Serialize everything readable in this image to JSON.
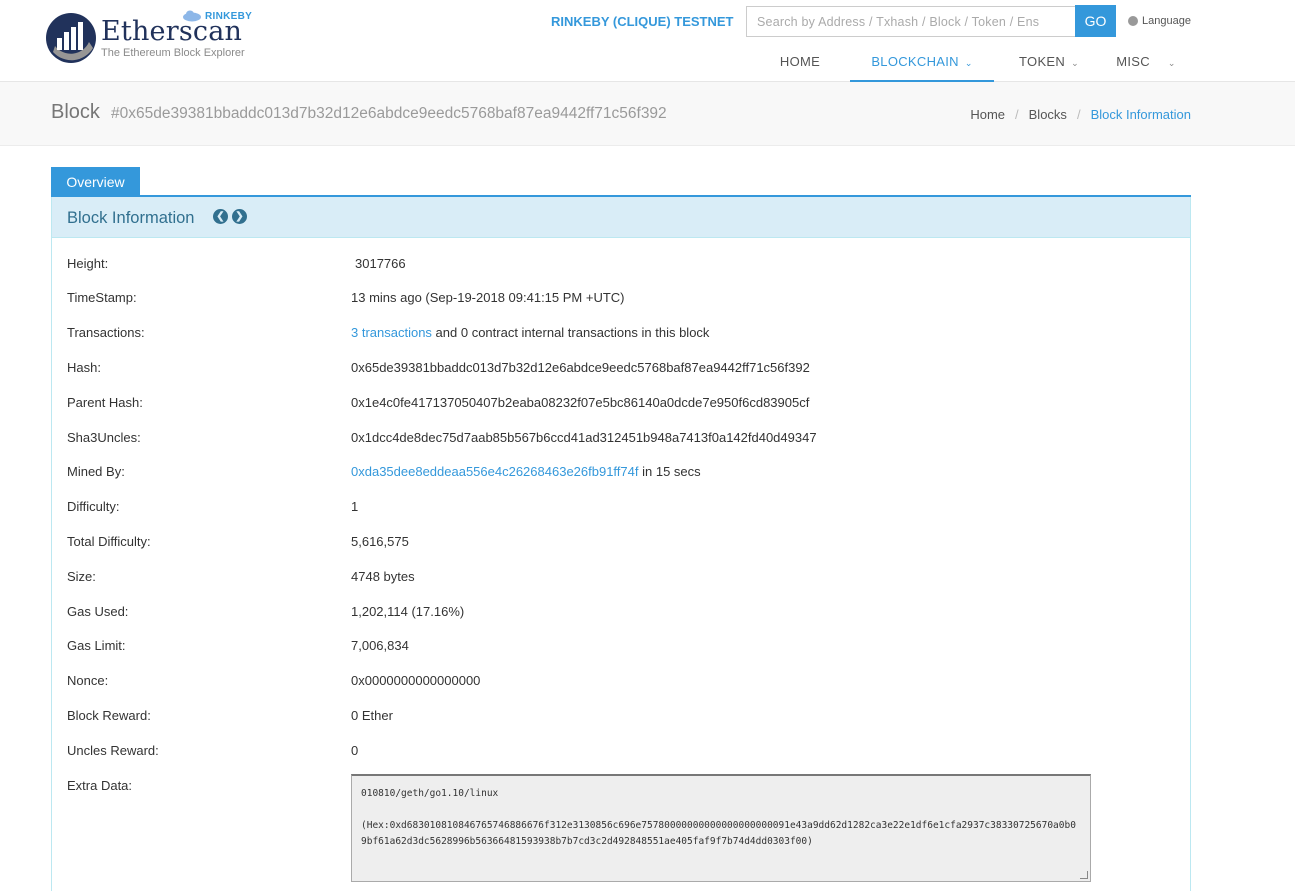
{
  "logo": {
    "wordmark": "Etherscan",
    "tagline": "The Ethereum Block Explorer",
    "network_badge": "RINKEBY"
  },
  "header": {
    "testnet_label": "RINKEBY (CLIQUE) TESTNET",
    "search_placeholder": "Search by Address / Txhash / Block / Token / Ens",
    "go_label": "GO",
    "language_label": "Language"
  },
  "nav": {
    "items": [
      {
        "label": "HOME"
      },
      {
        "label": "BLOCKCHAIN",
        "active": true
      },
      {
        "label": "TOKEN"
      },
      {
        "label": "MISC"
      }
    ]
  },
  "page": {
    "title": "Block",
    "hash": "#0x65de39381bbaddc013d7b32d12e6abdce9eedc5768baf87ea9442ff71c56f392"
  },
  "breadcrumb": [
    "Home",
    "Blocks",
    "Block Information"
  ],
  "tabs": {
    "overview": "Overview"
  },
  "panel": {
    "title": "Block Information"
  },
  "block": {
    "height_label": "Height:",
    "height": "3017766",
    "timestamp_label": "TimeStamp:",
    "timestamp": "13 mins ago (Sep-19-2018 09:41:15 PM +UTC)",
    "transactions_label": "Transactions:",
    "transactions_link": "3 transactions",
    "transactions_suffix": " and 0 contract internal transactions in this block",
    "hash_label": "Hash:",
    "hash": "0x65de39381bbaddc013d7b32d12e6abdce9eedc5768baf87ea9442ff71c56f392",
    "parent_hash_label": "Parent Hash:",
    "parent_hash": "0x1e4c0fe417137050407b2eaba08232f07e5bc86140a0dcde7e950f6cd83905cf",
    "sha3uncles_label": "Sha3Uncles:",
    "sha3uncles": "0x1dcc4de8dec75d7aab85b567b6ccd41ad312451b948a7413f0a142fd40d49347",
    "mined_by_label": "Mined By:",
    "mined_by": "0xda35dee8eddeaa556e4c26268463e26fb91ff74f",
    "mined_by_suffix": " in 15 secs",
    "difficulty_label": "Difficulty:",
    "difficulty": "1",
    "total_difficulty_label": "Total Difficulty:",
    "total_difficulty": "5,616,575",
    "size_label": "Size:",
    "size": "4748 bytes",
    "gas_used_label": "Gas Used:",
    "gas_used": "1,202,114 (17.16%)",
    "gas_limit_label": "Gas Limit:",
    "gas_limit": "7,006,834",
    "nonce_label": "Nonce:",
    "nonce": "0x0000000000000000",
    "block_reward_label": "Block Reward:",
    "block_reward": "0 Ether",
    "uncles_reward_label": "Uncles Reward:",
    "uncles_reward": "0",
    "extra_data_label": "Extra Data:",
    "extra_data_text": "010810/geth/go1.10/linux",
    "extra_data_hex": "(Hex:0xd683010810846765746886676f312e3130856c696e75780000000000000000000091e43a9dd62d1282ca3e22e1df6e1cfa2937c38330725670a0b09bf61a62d3dc5628996b56366481593938b7b7cd3c2d492848551ae405faf9f7b74d4dd0303f00)"
  },
  "colors": {
    "accent": "#3498db",
    "panel_head": "#d9edf7",
    "panel_title": "#31708f"
  }
}
